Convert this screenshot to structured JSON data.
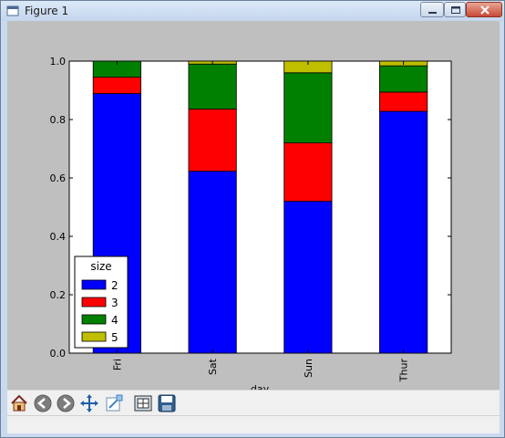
{
  "window": {
    "title": "Figure 1"
  },
  "chart_data": {
    "type": "bar",
    "stacked": true,
    "categories": [
      "Fri",
      "Sat",
      "Sun",
      "Thur"
    ],
    "series": [
      {
        "name": "2",
        "color": "#0000ff",
        "values": [
          0.889,
          0.623,
          0.52,
          0.828
        ]
      },
      {
        "name": "3",
        "color": "#ff0000",
        "values": [
          0.056,
          0.213,
          0.2,
          0.066
        ]
      },
      {
        "name": "4",
        "color": "#008000",
        "values": [
          0.055,
          0.154,
          0.24,
          0.09
        ]
      },
      {
        "name": "5",
        "color": "#bfbf00",
        "values": [
          0.0,
          0.01,
          0.04,
          0.016
        ]
      }
    ],
    "xlabel": "day",
    "ylabel": "",
    "ylim": [
      0.0,
      1.0
    ],
    "yticks": [
      "0.0",
      "0.2",
      "0.4",
      "0.6",
      "0.8",
      "1.0"
    ],
    "legend": {
      "title": "size",
      "placement": "lower-left"
    },
    "grid": false
  },
  "toolbar": {
    "icons": [
      "home-icon",
      "back-icon",
      "forward-icon",
      "pan-icon",
      "zoom-icon",
      "subplots-icon",
      "save-icon"
    ]
  }
}
